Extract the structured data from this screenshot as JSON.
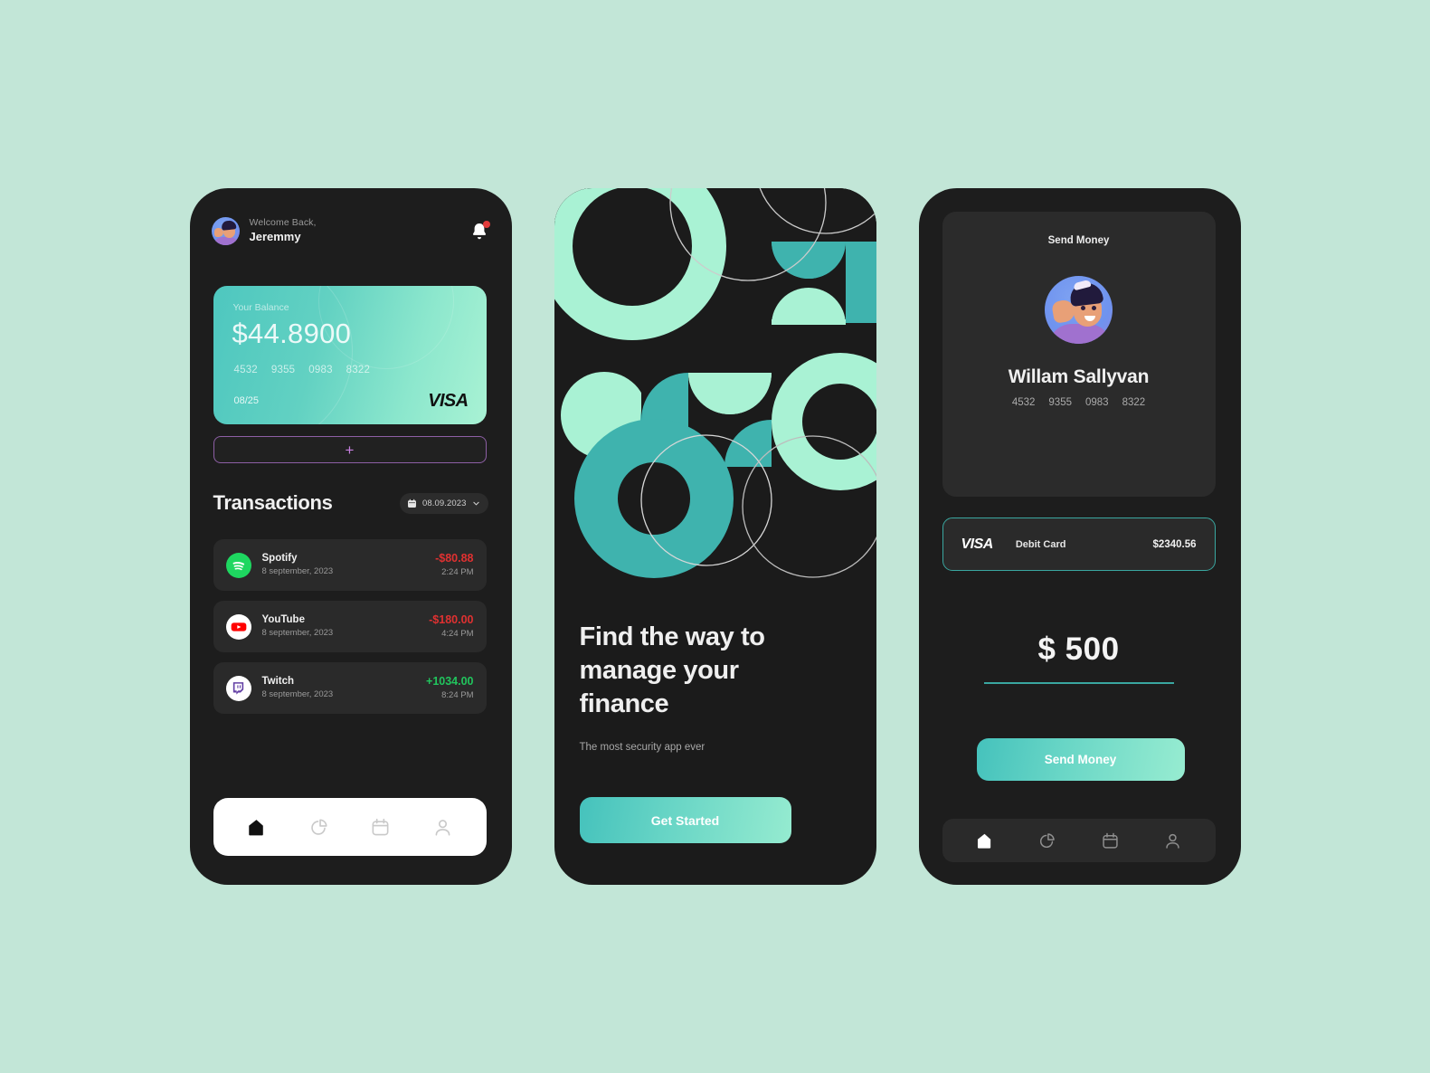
{
  "theme": {
    "page_bg": "#c2e6d7",
    "phone_bg": "#1d1d1d",
    "card_gradient_from": "#4ec7bf",
    "card_gradient_to": "#a9f2d4",
    "accent_teal": "#3aa7a0",
    "accent_purple": "#c77fe0",
    "negative": "#e03131",
    "positive": "#21c55d",
    "mint_light": "#a9f2d4",
    "teal_mid": "#3fb3ae"
  },
  "screen_home": {
    "greeting_small": "Welcome Back,",
    "user_name": "Jeremmy",
    "avatar_icon": "avatar-illustration",
    "bell_icon": "bell-icon",
    "bell_has_badge": true,
    "card": {
      "balance_label": "Your Balance",
      "balance_amount": "$44.8900",
      "number_groups": [
        "4532",
        "9355",
        "0983",
        "8322"
      ],
      "expiry": "08/25",
      "brand": "VISA"
    },
    "add_card_button": "+",
    "transactions_title": "Transactions",
    "date_filter": {
      "calendar_icon": "calendar-icon",
      "value": "08.09.2023",
      "chevron_icon": "chevron-down-icon"
    },
    "transactions": [
      {
        "icon": "spotify-icon",
        "name": "Spotify",
        "date": "8 september, 2023",
        "amount": "-$80.88",
        "amount_sign": "neg",
        "time": "2:24 PM"
      },
      {
        "icon": "youtube-icon",
        "name": "YouTube",
        "date": "8 september, 2023",
        "amount": "-$180.00",
        "amount_sign": "neg",
        "time": "4:24 PM"
      },
      {
        "icon": "twitch-icon",
        "name": "Twitch",
        "date": "8 september, 2023",
        "amount": "+1034.00",
        "amount_sign": "pos",
        "time": "8:24 PM"
      }
    ],
    "nav": [
      {
        "icon": "home-icon",
        "active": true
      },
      {
        "icon": "pie-chart-icon",
        "active": false
      },
      {
        "icon": "calendar-icon",
        "active": false
      },
      {
        "icon": "person-icon",
        "active": false
      }
    ]
  },
  "screen_onboarding": {
    "artwork_name": "geometric-pattern-artwork",
    "headline_line_1": "Find the way to",
    "headline_line_2": "manage your",
    "headline_line_3": "finance",
    "subtitle": "The most security app ever",
    "cta_label": "Get Started"
  },
  "screen_send": {
    "card_title": "Send Money",
    "avatar_icon": "avatar-illustration",
    "recipient_name": "Willam Sallyvan",
    "number_groups": [
      "4532",
      "9355",
      "0983",
      "8322"
    ],
    "payment_method": {
      "brand": "VISA",
      "label": "Debit Card",
      "balance": "$2340.56"
    },
    "amount": "$ 500",
    "submit_label": "Send Money",
    "nav": [
      {
        "icon": "home-icon",
        "active": true
      },
      {
        "icon": "pie-chart-icon",
        "active": false
      },
      {
        "icon": "calendar-icon",
        "active": false
      },
      {
        "icon": "person-icon",
        "active": false
      }
    ]
  }
}
